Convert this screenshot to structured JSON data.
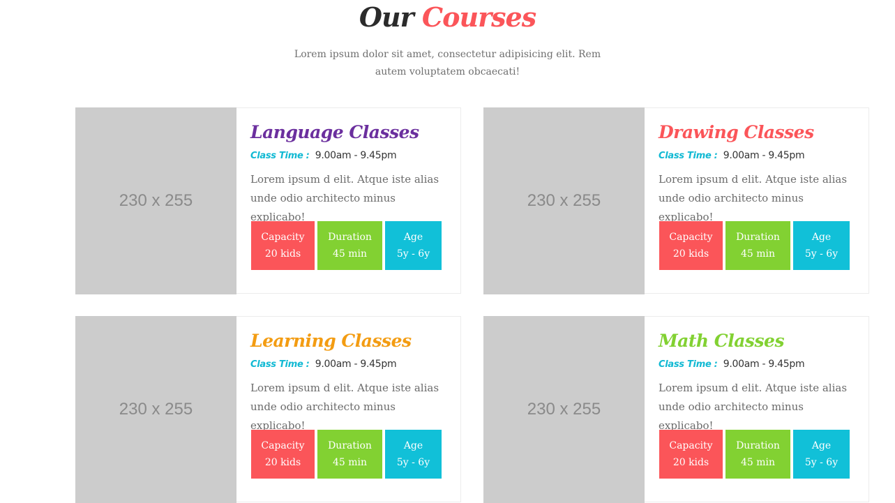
{
  "heading": {
    "title_part1": "Our",
    "title_part2": "Courses",
    "subtitle": "Lorem ipsum dolor sit amet, consectetur adipisicing elit. Rem autem voluptatem obcaecati!"
  },
  "colors": {
    "accent_red": "#fb5559",
    "accent_green": "#82d132",
    "accent_blue": "#11c0d8",
    "purple": "#6b2f9e",
    "orange": "#f39c12"
  },
  "courses": [
    {
      "image_placeholder": "230 x 255",
      "name": "Language Classes",
      "name_color": "#6b2f9e",
      "time_label": "Class Time :",
      "time_value": "9.00am - 9.45pm",
      "description": "Lorem ipsum d elit. Atque iste alias unde odio architecto minus explicabo!",
      "capacity_label": "Capacity",
      "capacity_value": "20 kids",
      "duration_label": "Duration",
      "duration_value": "45 min",
      "age_label": "Age",
      "age_value": "5y - 6y"
    },
    {
      "image_placeholder": "230 x 255",
      "name": "Drawing Classes",
      "name_color": "#fb5559",
      "time_label": "Class Time :",
      "time_value": "9.00am - 9.45pm",
      "description": "Lorem ipsum d elit. Atque iste alias unde odio architecto minus explicabo!",
      "capacity_label": "Capacity",
      "capacity_value": "20 kids",
      "duration_label": "Duration",
      "duration_value": "45 min",
      "age_label": "Age",
      "age_value": "5y - 6y"
    },
    {
      "image_placeholder": "230 x 255",
      "name": "Learning Classes",
      "name_color": "#f39c12",
      "time_label": "Class Time :",
      "time_value": "9.00am - 9.45pm",
      "description": "Lorem ipsum d elit. Atque iste alias unde odio architecto minus explicabo!",
      "capacity_label": "Capacity",
      "capacity_value": "20 kids",
      "duration_label": "Duration",
      "duration_value": "45 min",
      "age_label": "Age",
      "age_value": "5y - 6y"
    },
    {
      "image_placeholder": "230 x 255",
      "name": "Math Classes",
      "name_color": "#82d132",
      "time_label": "Class Time :",
      "time_value": "9.00am - 9.45pm",
      "description": "Lorem ipsum d elit. Atque iste alias unde odio architecto minus explicabo!",
      "capacity_label": "Capacity",
      "capacity_value": "20 kids",
      "duration_label": "Duration",
      "duration_value": "45 min",
      "age_label": "Age",
      "age_value": "5y - 6y"
    }
  ]
}
